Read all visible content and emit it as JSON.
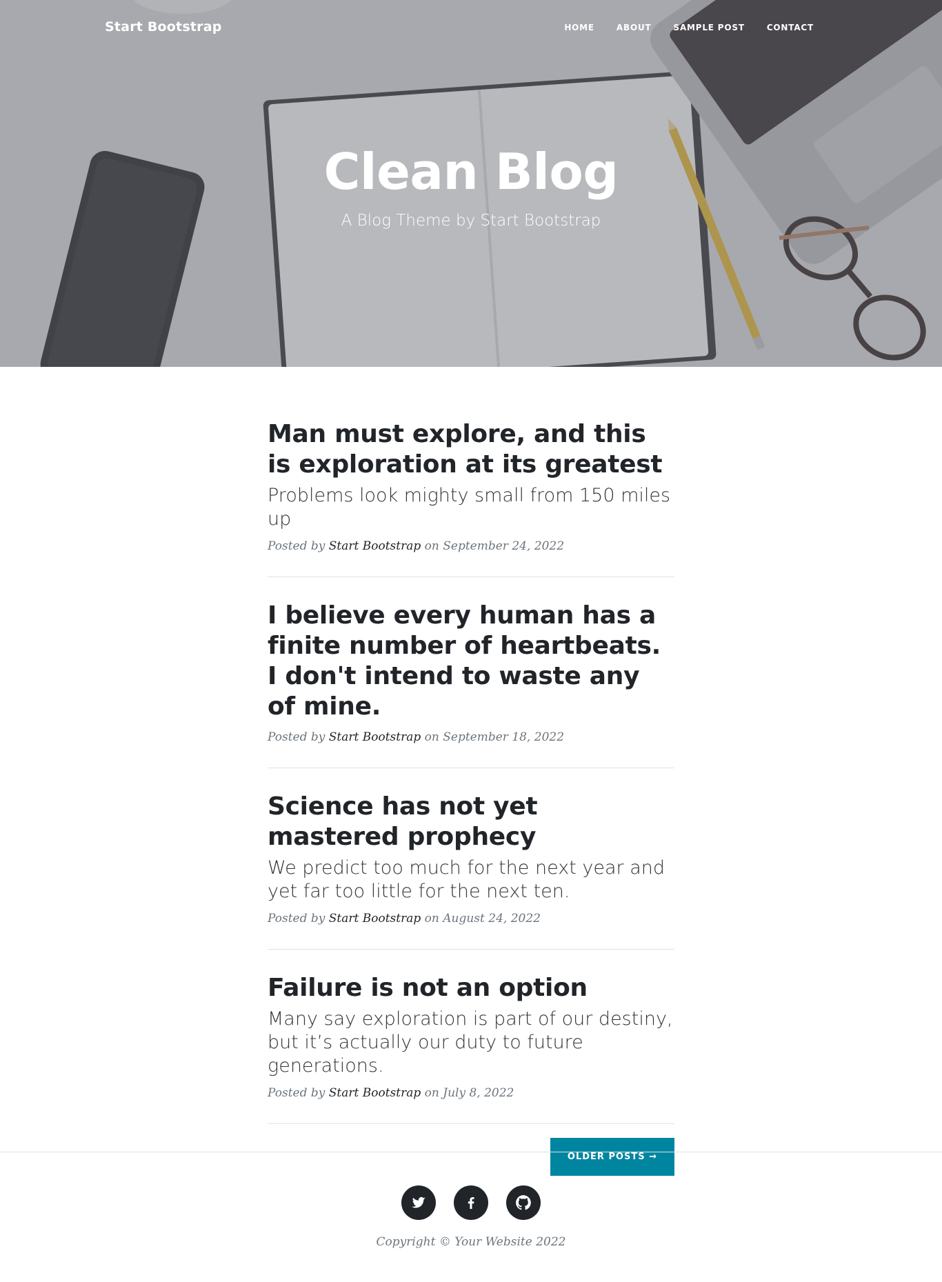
{
  "nav": {
    "brand": "Start Bootstrap",
    "links": [
      "Home",
      "About",
      "Sample Post",
      "Contact"
    ]
  },
  "hero": {
    "title": "Clean Blog",
    "subtitle": "A Blog Theme by Start Bootstrap"
  },
  "posts": [
    {
      "title": "Man must explore, and this is exploration at its greatest",
      "subtitle": "Problems look mighty small from 150 miles up",
      "posted_by_prefix": "Posted by",
      "author": "Start Bootstrap",
      "on_word": "on",
      "date": "September 24, 2022"
    },
    {
      "title": "I believe every human has a finite number of heartbeats. I don't intend to waste any of mine.",
      "subtitle": "",
      "posted_by_prefix": "Posted by",
      "author": "Start Bootstrap",
      "on_word": "on",
      "date": "September 18, 2022"
    },
    {
      "title": "Science has not yet mastered prophecy",
      "subtitle": "We predict too much for the next year and yet far too little for the next ten.",
      "posted_by_prefix": "Posted by",
      "author": "Start Bootstrap",
      "on_word": "on",
      "date": "August 24, 2022"
    },
    {
      "title": "Failure is not an option",
      "subtitle": "Many say exploration is part of our destiny, but it’s actually our duty to future generations.",
      "posted_by_prefix": "Posted by",
      "author": "Start Bootstrap",
      "on_word": "on",
      "date": "July 8, 2022"
    }
  ],
  "pager": {
    "older_label": "Older Posts →"
  },
  "footer": {
    "social_icons": [
      "twitter-icon",
      "facebook-icon",
      "github-icon"
    ],
    "copyright": "Copyright © Your Website 2022"
  },
  "colors": {
    "accent": "#0085a1",
    "text": "#212529",
    "muted": "#6c757d"
  }
}
